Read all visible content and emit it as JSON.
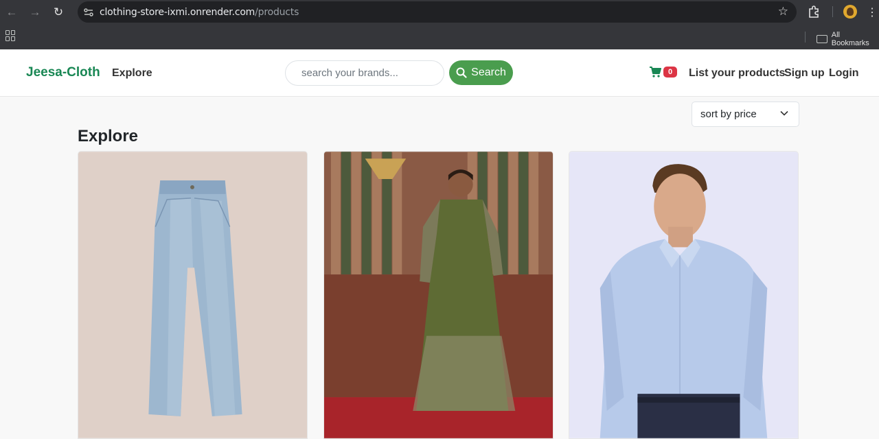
{
  "browser": {
    "url_host": "clothing-store-ixmi.onrender.com",
    "url_path": "/products",
    "bookmarks_label": "All Bookmarks"
  },
  "header": {
    "brand": "Jeesa-Cloth",
    "nav_explore": "Explore",
    "search_placeholder": "search your brands...",
    "search_button": "Search",
    "cart_count": "0",
    "list_products": "List your products",
    "signup": "Sign up",
    "login": "Login"
  },
  "main": {
    "sort_label": "sort by price",
    "title": "Explore",
    "products": [
      {
        "image": "jeans",
        "bg": "#dfd0c8"
      },
      {
        "image": "green-dress",
        "bg": "#6b4a3a"
      },
      {
        "image": "blue-shirt",
        "bg": "#e6e6f7"
      }
    ]
  },
  "colors": {
    "brand_green": "#198754",
    "search_green": "#4a9d4e",
    "badge_red": "#dc3545"
  }
}
